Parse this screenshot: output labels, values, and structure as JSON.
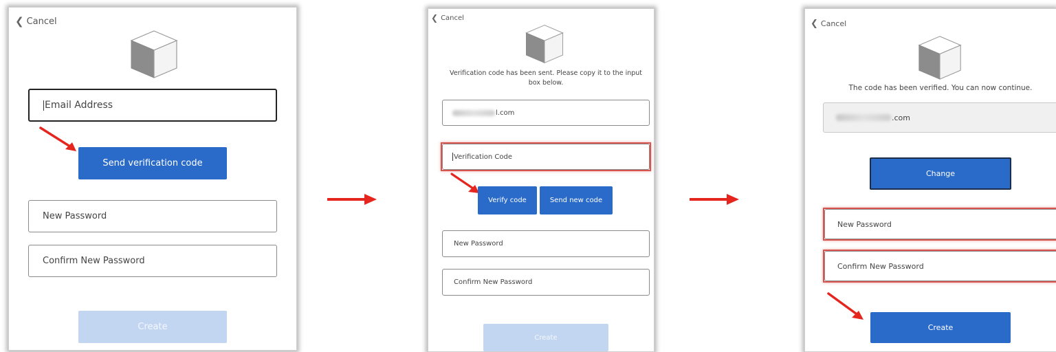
{
  "panel1": {
    "cancel": "Cancel",
    "email_placeholder": "Email Address",
    "send_button": "Send verification code",
    "new_password": "New Password",
    "confirm_password": "Confirm New Password",
    "create_button": "Create"
  },
  "panel2": {
    "cancel": "Cancel",
    "message": "Verification code has been sent. Please copy it to the input box below.",
    "email_suffix": "l.com",
    "code_placeholder": "Verification Code",
    "verify_button": "Verify code",
    "resend_button": "Send new code",
    "new_password": "New Password",
    "confirm_password": "Confirm New Password",
    "create_button": "Create"
  },
  "panel3": {
    "cancel": "Cancel",
    "message": "The code has been verified. You can now continue.",
    "email_suffix": ".com",
    "change_button": "Change",
    "new_password": "New Password",
    "confirm_password": "Confirm New Password",
    "create_button": "Create"
  },
  "colors": {
    "primary": "#2a6ac8",
    "disabled": "#c3d6f1",
    "highlight": "#d9534f",
    "arrow": "#e5261f"
  }
}
